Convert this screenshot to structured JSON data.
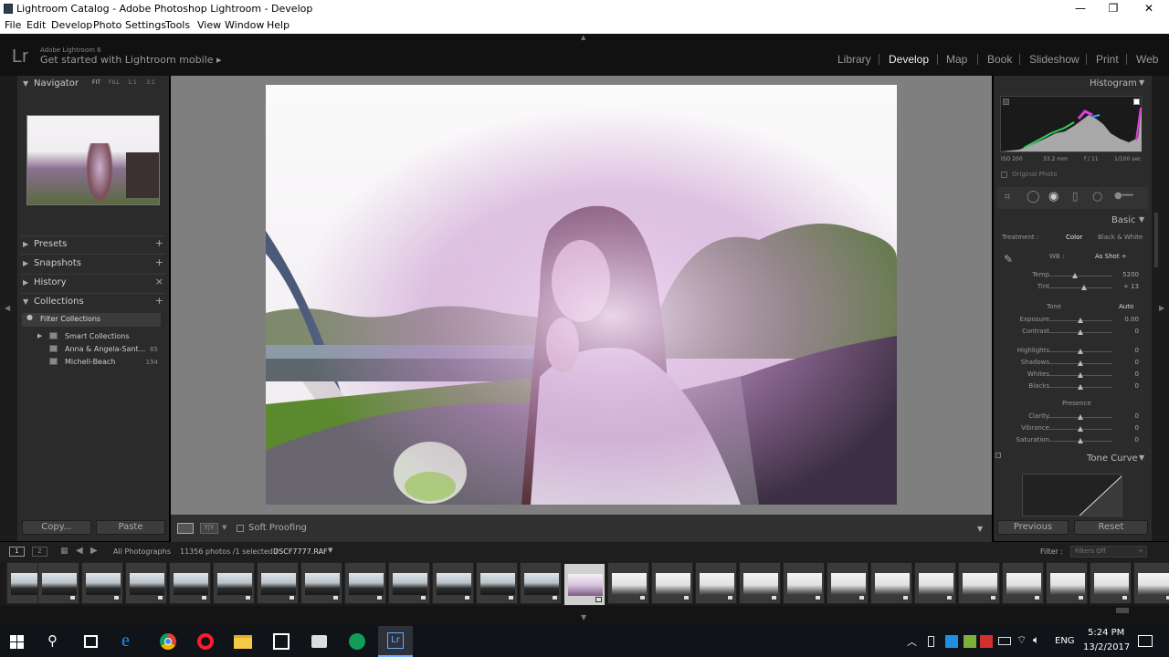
{
  "window": {
    "title": "Lightroom Catalog - Adobe Photoshop Lightroom - Develop",
    "minimize": "—",
    "maximize": "❐",
    "close": "✕"
  },
  "menu": [
    "File",
    "Edit",
    "Develop",
    "Photo",
    "Settings",
    "Tools",
    "View",
    "Window",
    "Help"
  ],
  "identity": {
    "logo": "Lr",
    "version": "Adobe Lightroom 6",
    "mobile": "Get started with Lightroom mobile ▸"
  },
  "modules": [
    "Library",
    "Develop",
    "Map",
    "Book",
    "Slideshow",
    "Print",
    "Web"
  ],
  "active_module": "Develop",
  "left": {
    "navigator": {
      "label": "Navigator",
      "zoom": [
        "FIT",
        "FILL",
        "1:1",
        "3:1"
      ]
    },
    "panels": [
      {
        "label": "Presets",
        "action": "+"
      },
      {
        "label": "Snapshots",
        "action": "+"
      },
      {
        "label": "History",
        "action": "×"
      },
      {
        "label": "Collections",
        "action": "+"
      }
    ],
    "filter": "Filter Collections",
    "collections": [
      {
        "name": "Smart Collections",
        "count": ""
      },
      {
        "name": "Anna & Angela-Sant...",
        "count": "65"
      },
      {
        "name": "Michell-Beach",
        "count": "194"
      }
    ],
    "copy": "Copy...",
    "paste": "Paste"
  },
  "toolbar": {
    "soft_proofing": "Soft Proofing"
  },
  "right": {
    "histogram_label": "Histogram",
    "exif": [
      "ISO 200",
      "33.2 mm",
      "f / 11",
      "1/100 sec"
    ],
    "original_photo": "Original Photo",
    "basic_label": "Basic",
    "treatment_label": "Treatment :",
    "treatment_color": "Color",
    "treatment_bw": "Black & White",
    "wb_label": "WB :",
    "wb_value": "As Shot ÷",
    "wb_sliders": [
      {
        "label": "Temp",
        "value": "5200",
        "pos": 0.42
      },
      {
        "label": "Tint",
        "value": "+ 13",
        "pos": 0.55
      }
    ],
    "tone_label": "Tone",
    "auto": "Auto",
    "tone_sliders": [
      {
        "label": "Exposure",
        "value": "0.00",
        "pos": 0.5
      },
      {
        "label": "Contrast",
        "value": "0",
        "pos": 0.5
      }
    ],
    "tone_sliders2": [
      {
        "label": "Highlights",
        "value": "0",
        "pos": 0.5
      },
      {
        "label": "Shadows",
        "value": "0",
        "pos": 0.5
      },
      {
        "label": "Whites",
        "value": "0",
        "pos": 0.5
      },
      {
        "label": "Blacks",
        "value": "0",
        "pos": 0.5
      }
    ],
    "presence_label": "Presence",
    "presence_sliders": [
      {
        "label": "Clarity",
        "value": "0",
        "pos": 0.5
      },
      {
        "label": "Vibrance",
        "value": "0",
        "pos": 0.5
      },
      {
        "label": "Saturation",
        "value": "0",
        "pos": 0.5
      }
    ],
    "tone_curve_label": "Tone Curve",
    "previous": "Previous",
    "reset": "Reset"
  },
  "filmbar": {
    "view1": "1",
    "view2": "2",
    "source": "All Photographs",
    "count": "11356 photos /1 selected /",
    "file": "DSCF7777.RAF",
    "filter_label": "Filter :",
    "filter_value": "Filters Off"
  },
  "taskbar": {
    "lang": "ENG",
    "time": "5:24 PM",
    "date": "13/2/2017"
  }
}
